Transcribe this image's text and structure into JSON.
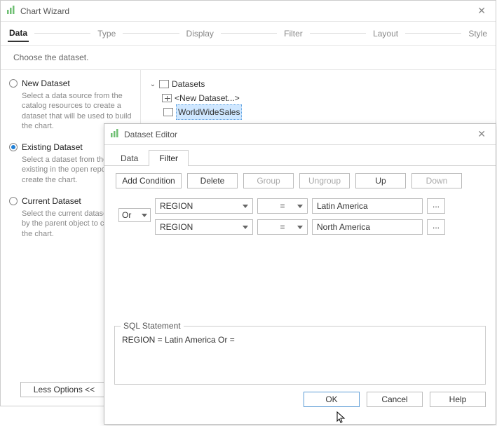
{
  "wizard": {
    "title": "Chart Wizard",
    "steps": [
      "Data",
      "Type",
      "Display",
      "Filter",
      "Layout",
      "Style"
    ],
    "active_step": "Data",
    "subheading": "Choose the dataset.",
    "less_options": "Less Options <<"
  },
  "options": {
    "new": {
      "label": "New Dataset",
      "desc": "Select a data source from the catalog resources to create a dataset that will be used to build the chart."
    },
    "existing": {
      "label": "Existing Dataset",
      "desc": "Select a dataset from those existing in the open report to create the chart."
    },
    "current": {
      "label": "Current Dataset",
      "desc": "Select the current dataset used by the parent object to create the chart."
    }
  },
  "tree": {
    "root": "Datasets",
    "new_item": "<New Dataset...>",
    "selected": "WorldWideSales"
  },
  "editor": {
    "title": "Dataset Editor",
    "tabs": {
      "data": "Data",
      "filter": "Filter"
    },
    "toolbar": {
      "add": "Add Condition",
      "delete": "Delete",
      "group": "Group",
      "ungroup": "Ungroup",
      "up": "Up",
      "down": "Down"
    },
    "logic": "Or",
    "conditions": [
      {
        "field": "REGION",
        "op": "=",
        "value": "Latin America"
      },
      {
        "field": "REGION",
        "op": "=",
        "value": "North America"
      }
    ],
    "sql": {
      "legend": "SQL Statement",
      "text": "REGION = Latin America Or  ="
    },
    "buttons": {
      "ok": "OK",
      "cancel": "Cancel",
      "help": "Help"
    }
  }
}
